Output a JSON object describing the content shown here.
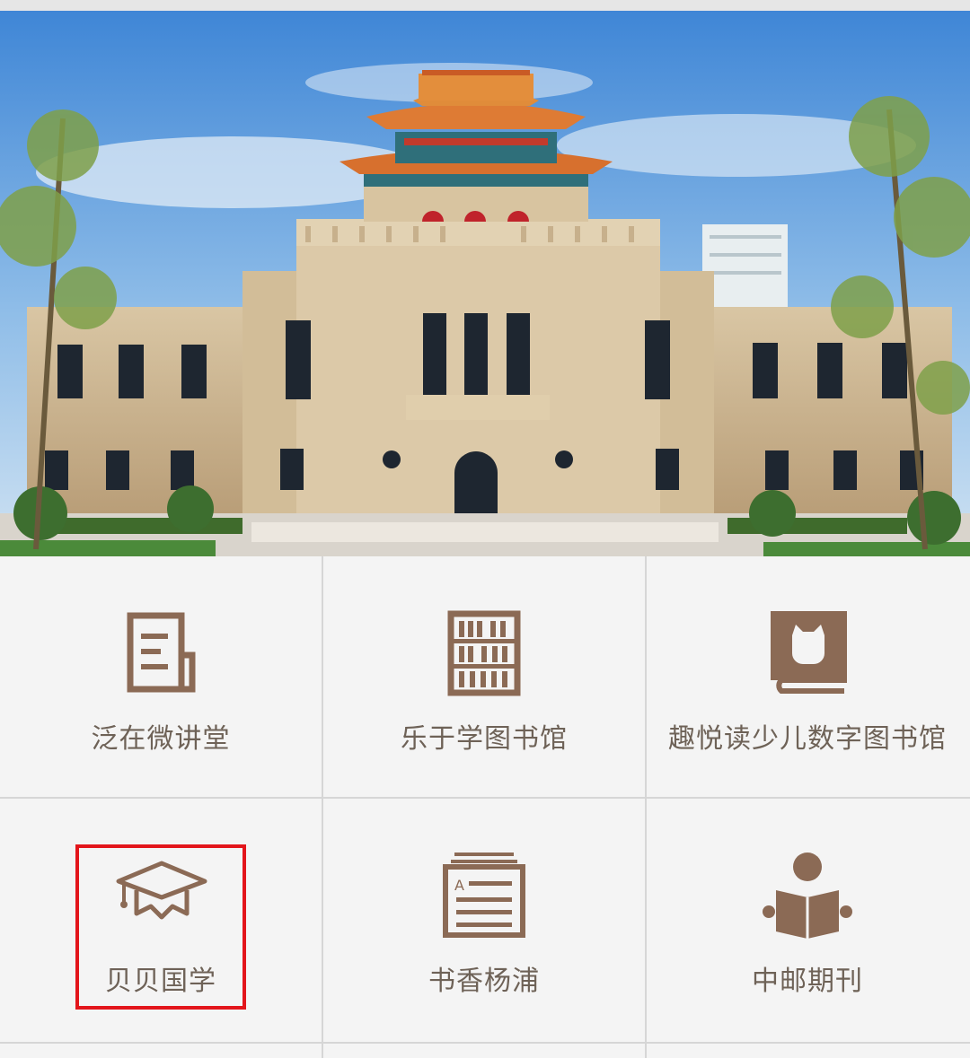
{
  "banner": {
    "alt_name": "library-building-photo"
  },
  "grid": {
    "items": [
      {
        "label": "泛在微讲堂",
        "icon": "document-icon"
      },
      {
        "label": "乐于学图书馆",
        "icon": "bookshelf-icon"
      },
      {
        "label": "趣悦读少儿数字图书馆",
        "icon": "cat-book-icon"
      },
      {
        "label": "贝贝国学",
        "icon": "graduation-cap-icon"
      },
      {
        "label": "书香杨浦",
        "icon": "article-icon"
      },
      {
        "label": "中邮期刊",
        "icon": "reader-icon"
      }
    ]
  },
  "colors": {
    "icon": "#8b6a55",
    "label": "#6e6257",
    "highlight": "#e3151b",
    "divider": "#d6d6d6"
  }
}
